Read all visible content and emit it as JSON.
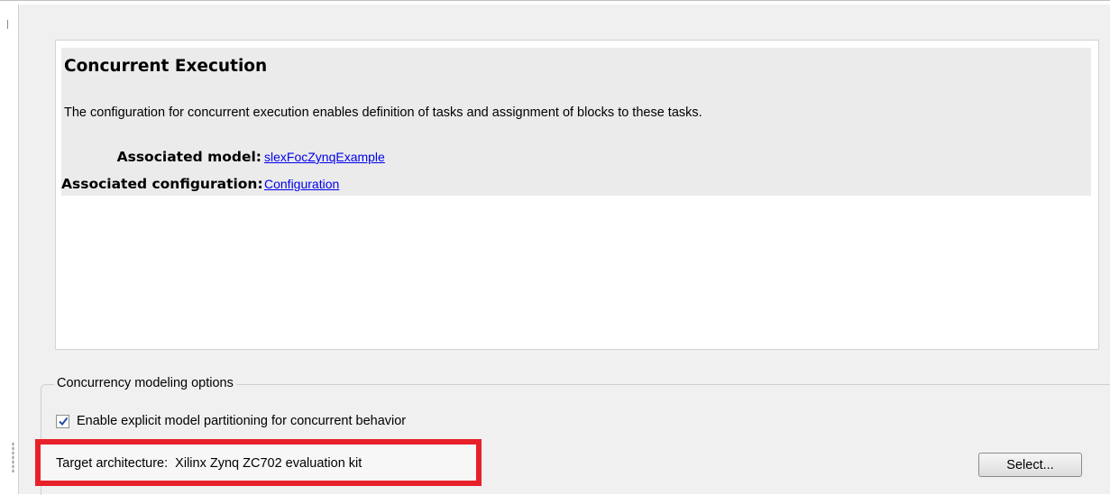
{
  "description": {
    "title": "Concurrent Execution",
    "text": "The configuration for concurrent execution enables definition of tasks and assignment of blocks to these tasks.",
    "associated_model_label": "Associated model:",
    "associated_model_link": "slexFocZynqExample",
    "associated_config_label": "Associated configuration:",
    "associated_config_link": "Configuration"
  },
  "options": {
    "group_label": "Concurrency modeling options",
    "partitioning_checkbox_label": "Enable explicit model partitioning for concurrent behavior",
    "partitioning_checked": true,
    "target_architecture": "Target architecture:  Xilinx Zynq ZC702 evaluation kit",
    "select_button": "Select..."
  },
  "colors": {
    "highlight_border": "#e8202a",
    "link": "#0000ee",
    "panel_bg": "#f0f0f0"
  }
}
